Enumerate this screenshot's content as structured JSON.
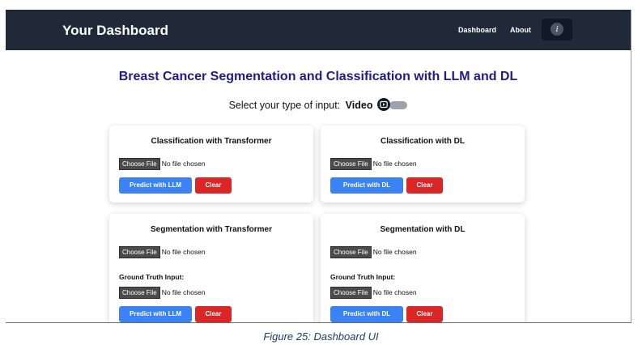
{
  "navbar": {
    "brand": "Your Dashboard",
    "links": [
      "Dashboard",
      "About"
    ],
    "info_icon": "i"
  },
  "main": {
    "title": "Breast Cancer Segmentation and Classification with LLM and DL",
    "input_select": {
      "label": "Select your type of input:",
      "mode": "Video",
      "icon": "video-icon",
      "toggle": "off"
    },
    "cards": [
      {
        "title": "Classification with Transformer",
        "file_button": "Choose File",
        "file_status": "No file chosen",
        "predict": "Predict with LLM",
        "clear": "Clear"
      },
      {
        "title": "Classification with DL",
        "file_button": "Choose File",
        "file_status": "No file chosen",
        "predict": "Predict with DL",
        "clear": "Clear"
      },
      {
        "title": "Segmentation with Transformer",
        "file_button": "Choose File",
        "file_status": "No file chosen",
        "gt_label": "Ground Truth Input:",
        "gt_file_button": "Choose File",
        "gt_file_status": "No file chosen",
        "predict": "Predict with LLM",
        "clear": "Clear"
      },
      {
        "title": "Segmentation with DL",
        "file_button": "Choose File",
        "file_status": "No file chosen",
        "gt_label": "Ground Truth Input:",
        "gt_file_button": "Choose File",
        "gt_file_status": "No file chosen",
        "predict": "Predict with DL",
        "clear": "Clear"
      }
    ]
  },
  "caption": "Figure 25: Dashboard UI",
  "colors": {
    "navbar": "#1f2937",
    "title": "#1e1b8a",
    "primary": "#3b82f6",
    "danger": "#dc2626"
  }
}
